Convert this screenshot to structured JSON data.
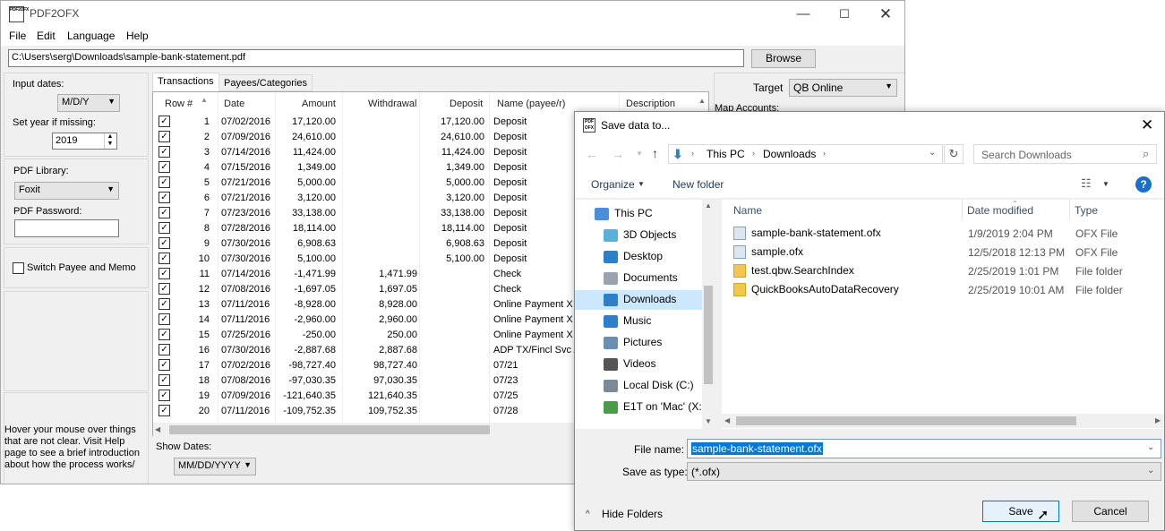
{
  "app": {
    "title": "PDF2OFX",
    "logo_text": "PDF2OFX",
    "menu": [
      "File",
      "Edit",
      "Language",
      "Help"
    ],
    "path": "C:\\Users\\serg\\Downloads\\sample-bank-statement.pdf",
    "browse_label": "Browse"
  },
  "left": {
    "input_dates_label": "Input dates:",
    "input_dates_value": "M/D/Y",
    "set_year_label": "Set year if missing:",
    "year_value": "2019",
    "pdf_library_label": "PDF Library:",
    "pdf_library_value": "Foxit",
    "pdf_password_label": "PDF Password:",
    "switch_label": "Switch Payee and Memo",
    "hint": "Hover your mouse over things that are not clear. Visit Help page to see a brief introduction about how the process works/"
  },
  "tabs": [
    "Transactions",
    "Payees/Categories"
  ],
  "grid": {
    "columns": [
      "Row #",
      "Date",
      "Amount",
      "Withdrawal",
      "Deposit",
      "Name (payee/r)",
      "Description"
    ],
    "rows": [
      [
        "1",
        "07/02/2016",
        "17,120.00",
        "",
        "17,120.00",
        "Deposit"
      ],
      [
        "2",
        "07/09/2016",
        "24,610.00",
        "",
        "24,610.00",
        "Deposit"
      ],
      [
        "3",
        "07/14/2016",
        "11,424.00",
        "",
        "11,424.00",
        "Deposit"
      ],
      [
        "4",
        "07/15/2016",
        "1,349.00",
        "",
        "1,349.00",
        "Deposit"
      ],
      [
        "5",
        "07/21/2016",
        "5,000.00",
        "",
        "5,000.00",
        "Deposit"
      ],
      [
        "6",
        "07/21/2016",
        "3,120.00",
        "",
        "3,120.00",
        "Deposit"
      ],
      [
        "7",
        "07/23/2016",
        "33,138.00",
        "",
        "33,138.00",
        "Deposit"
      ],
      [
        "8",
        "07/28/2016",
        "18,114.00",
        "",
        "18,114.00",
        "Deposit"
      ],
      [
        "9",
        "07/30/2016",
        "6,908.63",
        "",
        "6,908.63",
        "Deposit"
      ],
      [
        "10",
        "07/30/2016",
        "5,100.00",
        "",
        "5,100.00",
        "Deposit"
      ],
      [
        "11",
        "07/14/2016",
        "-1,471.99",
        "1,471.99",
        "",
        "Check"
      ],
      [
        "12",
        "07/08/2016",
        "-1,697.05",
        "1,697.05",
        "",
        "Check"
      ],
      [
        "13",
        "07/11/2016",
        "-8,928.00",
        "8,928.00",
        "",
        "Online Payment X T"
      ],
      [
        "14",
        "07/11/2016",
        "-2,960.00",
        "2,960.00",
        "",
        "Online Payment X T"
      ],
      [
        "15",
        "07/25/2016",
        "-250.00",
        "250.00",
        "",
        "Online Payment X T"
      ],
      [
        "16",
        "07/30/2016",
        "-2,887.68",
        "2,887.68",
        "",
        "ADP TX/Fincl Svc A"
      ],
      [
        "17",
        "07/02/2016",
        "-98,727.40",
        "98,727.40",
        "",
        "07/21"
      ],
      [
        "18",
        "07/08/2016",
        "-97,030.35",
        "97,030.35",
        "",
        "07/23"
      ],
      [
        "19",
        "07/09/2016",
        "-121,640.35",
        "121,640.35",
        "",
        "07/25"
      ],
      [
        "20",
        "07/11/2016",
        "-109,752.35",
        "109,752.35",
        "",
        "07/28"
      ]
    ],
    "check_mark": "✓"
  },
  "bottom": {
    "show_dates_label": "Show Dates:",
    "show_dates_value": "MM/DD/YYYY"
  },
  "right": {
    "target_label": "Target",
    "target_value": "QB Online",
    "map_accounts_label": "Map Accounts:"
  },
  "dialog": {
    "title": "Save data to...",
    "breadcrumb": [
      "This PC",
      "Downloads"
    ],
    "search_placeholder": "Search Downloads",
    "organize_label": "Organize",
    "new_folder_label": "New folder",
    "nav": [
      {
        "label": "This PC",
        "icon": "pc-icon",
        "color": "#4a90d9"
      },
      {
        "label": "3D Objects",
        "icon": "3d-objects-icon",
        "color": "#5ab0d8"
      },
      {
        "label": "Desktop",
        "icon": "desktop-icon",
        "color": "#2f7fc8"
      },
      {
        "label": "Documents",
        "icon": "documents-icon",
        "color": "#9aa4ae"
      },
      {
        "label": "Downloads",
        "icon": "downloads-icon",
        "color": "#2f7fc8"
      },
      {
        "label": "Music",
        "icon": "music-icon",
        "color": "#2f7fc8"
      },
      {
        "label": "Pictures",
        "icon": "pictures-icon",
        "color": "#6a8fb0"
      },
      {
        "label": "Videos",
        "icon": "videos-icon",
        "color": "#555555"
      },
      {
        "label": "Local Disk (C:)",
        "icon": "disk-icon",
        "color": "#7a8a96"
      },
      {
        "label": "E1T on 'Mac' (X:",
        "icon": "network-drive-icon",
        "color": "#4a9a4a"
      }
    ],
    "columns": [
      "Name",
      "Date modified",
      "Type"
    ],
    "files": [
      {
        "name": "sample-bank-statement.ofx",
        "date": "1/9/2019 2:04 PM",
        "type": "OFX File",
        "kind": "file"
      },
      {
        "name": "sample.ofx",
        "date": "12/5/2018 12:13 PM",
        "type": "OFX File",
        "kind": "file"
      },
      {
        "name": "test.qbw.SearchIndex",
        "date": "2/25/2019 1:01 PM",
        "type": "File folder",
        "kind": "folder"
      },
      {
        "name": "QuickBooksAutoDataRecovery",
        "date": "2/25/2019 10:01 AM",
        "type": "File folder",
        "kind": "folder"
      }
    ],
    "file_name_label": "File name:",
    "file_name_value": "sample-bank-statement.ofx",
    "save_type_label": "Save as type:",
    "save_type_value": "(*.ofx)",
    "hide_folders_label": "Hide Folders",
    "save_label": "Save",
    "cancel_label": "Cancel"
  }
}
